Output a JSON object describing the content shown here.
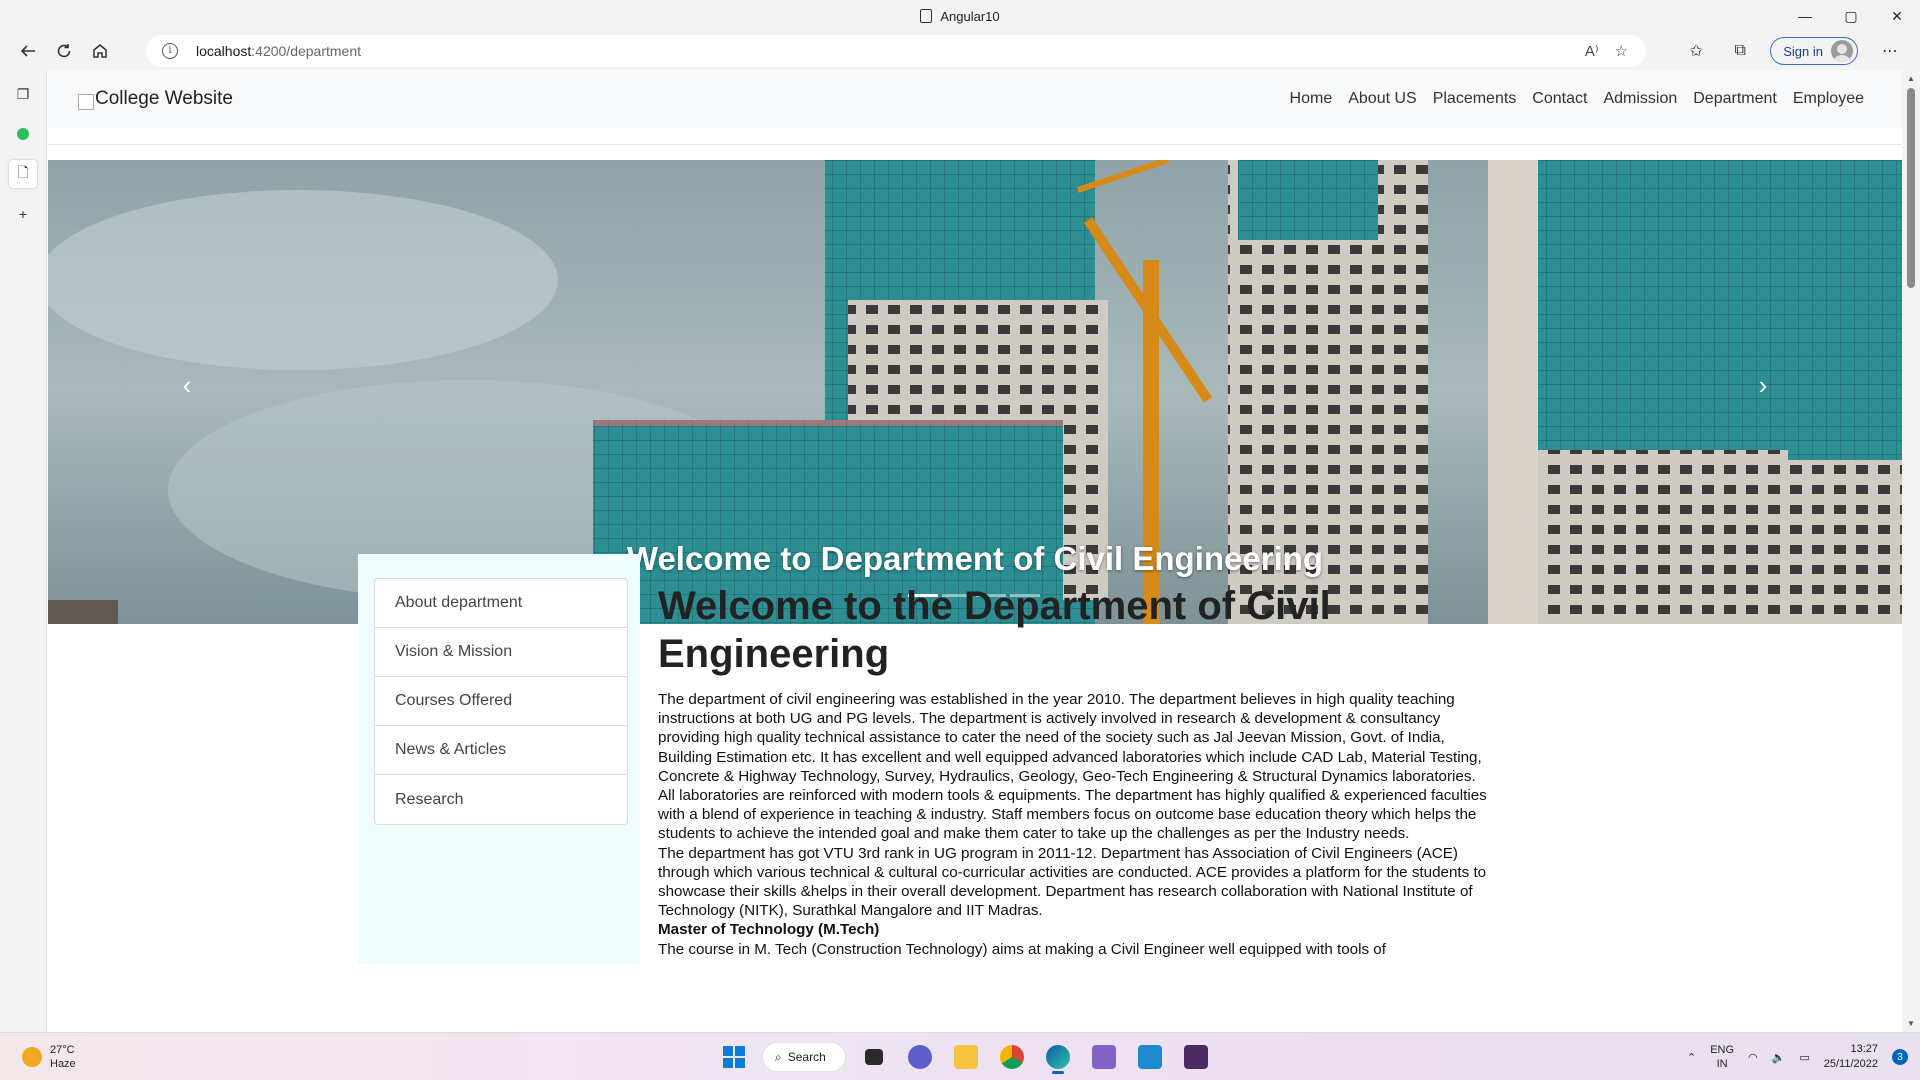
{
  "browser": {
    "tab_title": "Angular10",
    "url_host": "localhost",
    "url_path": ":4200/department",
    "sign_in_label": "Sign in",
    "controls": {
      "minimize": "—",
      "maximize": "▢",
      "close": "✕"
    }
  },
  "site": {
    "brand": "College Website",
    "nav": [
      "Home",
      "About US",
      "Placements",
      "Contact",
      "Admission",
      "Department",
      "Employee"
    ]
  },
  "hero": {
    "caption": "Welcome to Department of Civil Engineering",
    "prev_label": "‹",
    "next_label": "›",
    "slides": 4,
    "active_slide": 1
  },
  "sidebar_links": [
    "About department",
    "Vision & Mission",
    "Courses Offered",
    "News & Articles",
    "Research"
  ],
  "content": {
    "heading": "Welcome to the Department of Civil Engineering",
    "p1": "The department of civil engineering was established in the year 2010. The department believes in high quality teaching instructions at both UG and PG levels. The department is actively involved in research & development & consultancy providing high quality technical assistance to cater the need of the society such as Jal Jeevan Mission, Govt. of India, Building Estimation etc. It has excellent and well equipped advanced laboratories which include CAD Lab, Material Testing, Concrete & Highway Technology, Survey, Hydraulics, Geology, Geo-Tech Engineering & Structural Dynamics laboratories. All laboratories are reinforced with modern tools & equipments. The department has highly qualified & experienced faculties with a blend of experience in teaching & industry. Staff members focus on outcome base education theory which helps the students to achieve the intended goal and make them cater to take up the challenges as per the Industry needs.",
    "p2": "The department has got VTU 3rd rank in UG program in 2011-12. Department has Association of Civil Engineers (ACE) through which various technical & cultural co-curricular activities are conducted. ACE provides a platform for the students to showcase their skills &helps in their overall development. Department has research collaboration with National Institute of Technology (NITK), Surathkal Mangalore and IIT Madras.",
    "mtech_heading": "Master of Technology (M.Tech)",
    "p3": "The course in M. Tech (Construction Technology) aims at making a Civil Engineer well equipped with tools of"
  },
  "taskbar": {
    "temperature": "27°C",
    "weather": "Haze",
    "search_label": "Search",
    "lang_line1": "ENG",
    "lang_line2": "IN",
    "time": "13:27",
    "date": "25/11/2022",
    "notification_count": "3"
  },
  "colors": {
    "nav_bg": "#f8f9fa",
    "sidebar_col_bg": "#effdff",
    "taskbar_accent": "#0067c0",
    "signin_border": "#3b6ecb"
  }
}
